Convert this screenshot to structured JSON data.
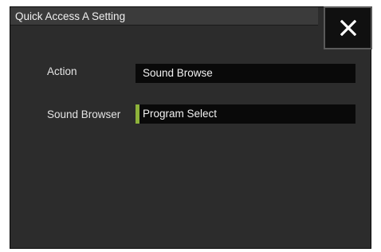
{
  "dialog": {
    "title": "Quick Access A Setting",
    "close_icon": "close-x-icon"
  },
  "rows": {
    "action": {
      "label": "Action",
      "value": "Sound Browse"
    },
    "sound_browser": {
      "label": "Sound Browser",
      "value": "Program Select",
      "marker_color": "#8db23a"
    }
  },
  "colors": {
    "panel_bg": "#2c2c2c",
    "title_bar_bg": "#3b3b3b",
    "field_bg": "#090909",
    "close_button_bg": "#101010"
  }
}
